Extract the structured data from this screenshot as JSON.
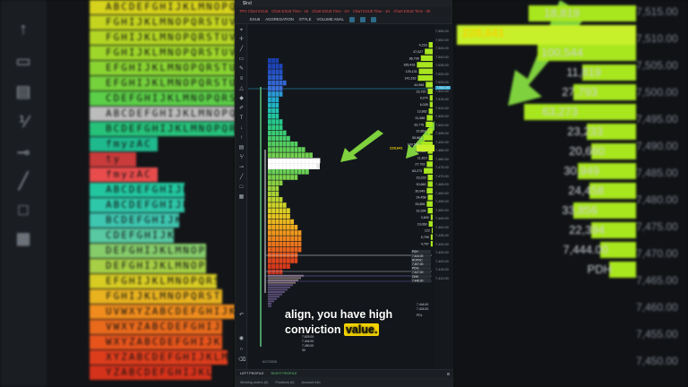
{
  "window": {
    "title": "$Ind"
  },
  "tabs": [
    "TPO Chart ESU6",
    "Chart ESU6 Time - 15",
    "Chart ESU6 Time - 4H",
    "Chart ESU6 Time - 1H",
    "Chart ESU6 Time - 30"
  ],
  "toolbar": {
    "symbol": "ESU6",
    "aggregation": "AGGREGATION",
    "style": "STYLE",
    "volume": "VOLUME ANAL"
  },
  "volume_labels": [
    "4,216",
    "47,027",
    "86,706",
    "165,416",
    "125,131",
    "142,162",
    "44,966",
    "23,720",
    "9,274",
    "6,028",
    "13,682",
    "31,586",
    "33,776",
    "22,863",
    "55,861",
    "100,544",
    "22,826",
    "11,819",
    "27,793",
    "63,273",
    "23,233",
    "20,660",
    "30,949",
    "24,458",
    "33,856",
    "22,394",
    "3,600",
    "19,060",
    "122",
    "5,799",
    "4,767"
  ],
  "poc_label": "228,641",
  "price_ticks": [
    "7,555.00",
    "7,550.00",
    "7,545.00",
    "7,540.00",
    "7,535.00",
    "7,530.00",
    "7,525.00",
    "7,520.00",
    "7,515.00",
    "7,510.00",
    "7,505.00",
    "7,500.00",
    "7,495.00",
    "7,490.00",
    "7,485.00",
    "7,480.00",
    "7,475.00",
    "7,470.00",
    "7,465.00",
    "7,460.00",
    "7,455.00",
    "7,450.00",
    "7,445.00",
    "7,440.00",
    "7,435.00",
    "7,430.00",
    "7,425.00",
    "7,420.00",
    "7,415.00",
    "7,410.00"
  ],
  "current_price": "7,542.00",
  "level_tags": [
    "PDH",
    "7,444.00",
    "ROPOC",
    "7,457.00",
    "PDVL",
    "7,447.00",
    "ONH",
    "7,448.00"
  ],
  "chart_labels": {
    "date": "6/17/2026",
    "pdl": "PDL",
    "stack": [
      "7,625.00",
      "7,444.00",
      "7,490.00",
      "30"
    ],
    "bottom_right": [
      "7,444.00",
      "7,424.00"
    ]
  },
  "bottom_tabs": {
    "left": "LEFT PROFILE",
    "right": "RIGHT PROFILE"
  },
  "status": [
    "Working orders (0)",
    "Positions (0)",
    "Account Info"
  ],
  "caption": {
    "line1": "align, you have high",
    "line2": "conviction ",
    "highlight": "value."
  },
  "background_right": {
    "labels": [
      "18,819",
      "228,641",
      "100,544",
      "11,819",
      "27,793",
      "63,273",
      "23,233",
      "20,660",
      "30,949",
      "24,458",
      "33,856",
      "22,394",
      "7,444.00",
      "PDH"
    ],
    "prices": [
      "7,515.00",
      "7,510.00",
      "7,505.00",
      "7,500.00",
      "7,495.00",
      "7,490.00",
      "7,485.00",
      "7,480.00",
      "7,475.00",
      "7,470.00",
      "7,465.00",
      "7,460.00",
      "7,455.00",
      "7,450.00"
    ]
  },
  "background_left": {
    "rows": [
      "ABCDEFGHIJKLMNOPQRSTUVWXYZ",
      "FGHIJKLMNOPQRSTUVWXYZ",
      "FGHIJKLMNOPQRSTUVWXYZ",
      "FGHIJKLMNOPQRSTUVWXYZ",
      "EFGHIJKLMNOPQRSTUVWXYZ",
      "EFGHIJKLMNOPQRSTUVWXYZ",
      "CDEFGHIJKLMNOPQRSTUVWXYZ",
      "ABCDEFGHIJKLMNOPQRSTUVWXYZ",
      "BCDEFGHIJKLMNOPQRSTUVWXYZ",
      "fmyzAC",
      "ty",
      "fmyzAC",
      "ABCDEFGHIJK",
      "ABCDEFGHIJK",
      "BCDEFGHIJK",
      "CDEFGHIJK",
      "DEFGHIJKLMNOPQR",
      "DEFGHIJKLMNOPQR",
      "EFGHIJKLMNOPQRSTU",
      "FGHIJKLMNOPQRSTUVW",
      "UVWXYZABCDEFGHIJKLMNO",
      "VWXYZABCDEFGHIJKLM",
      "WXYZABCDEFGHIJKLMN",
      "XYZABCDEFGHIJKLMNOP",
      "YZABCDEFGHIJKLMN"
    ],
    "colors": [
      "#d7d21c",
      "#c4d41f",
      "#b3d524",
      "#9ed62a",
      "#8ad432",
      "#75d13c",
      "#5ccf48",
      "#bcbcbc",
      "#26c27a",
      "#1fb98e",
      "#ca3b3b",
      "#e94c4c",
      "#22c7a0",
      "#2fc7a9",
      "#3ec6b0",
      "#58c9a2",
      "#86cc6b",
      "#a6cf46",
      "#d8cc23",
      "#e9b320",
      "#ef8c1d",
      "#ea6a1c",
      "#e6541c",
      "#de3d1c",
      "#d5321b"
    ]
  },
  "colors": {
    "accent_green": "#a8e61e",
    "poc_yellow": "#f5d400",
    "arrow_green": "#7fd13d",
    "panel": "#161a1f"
  }
}
